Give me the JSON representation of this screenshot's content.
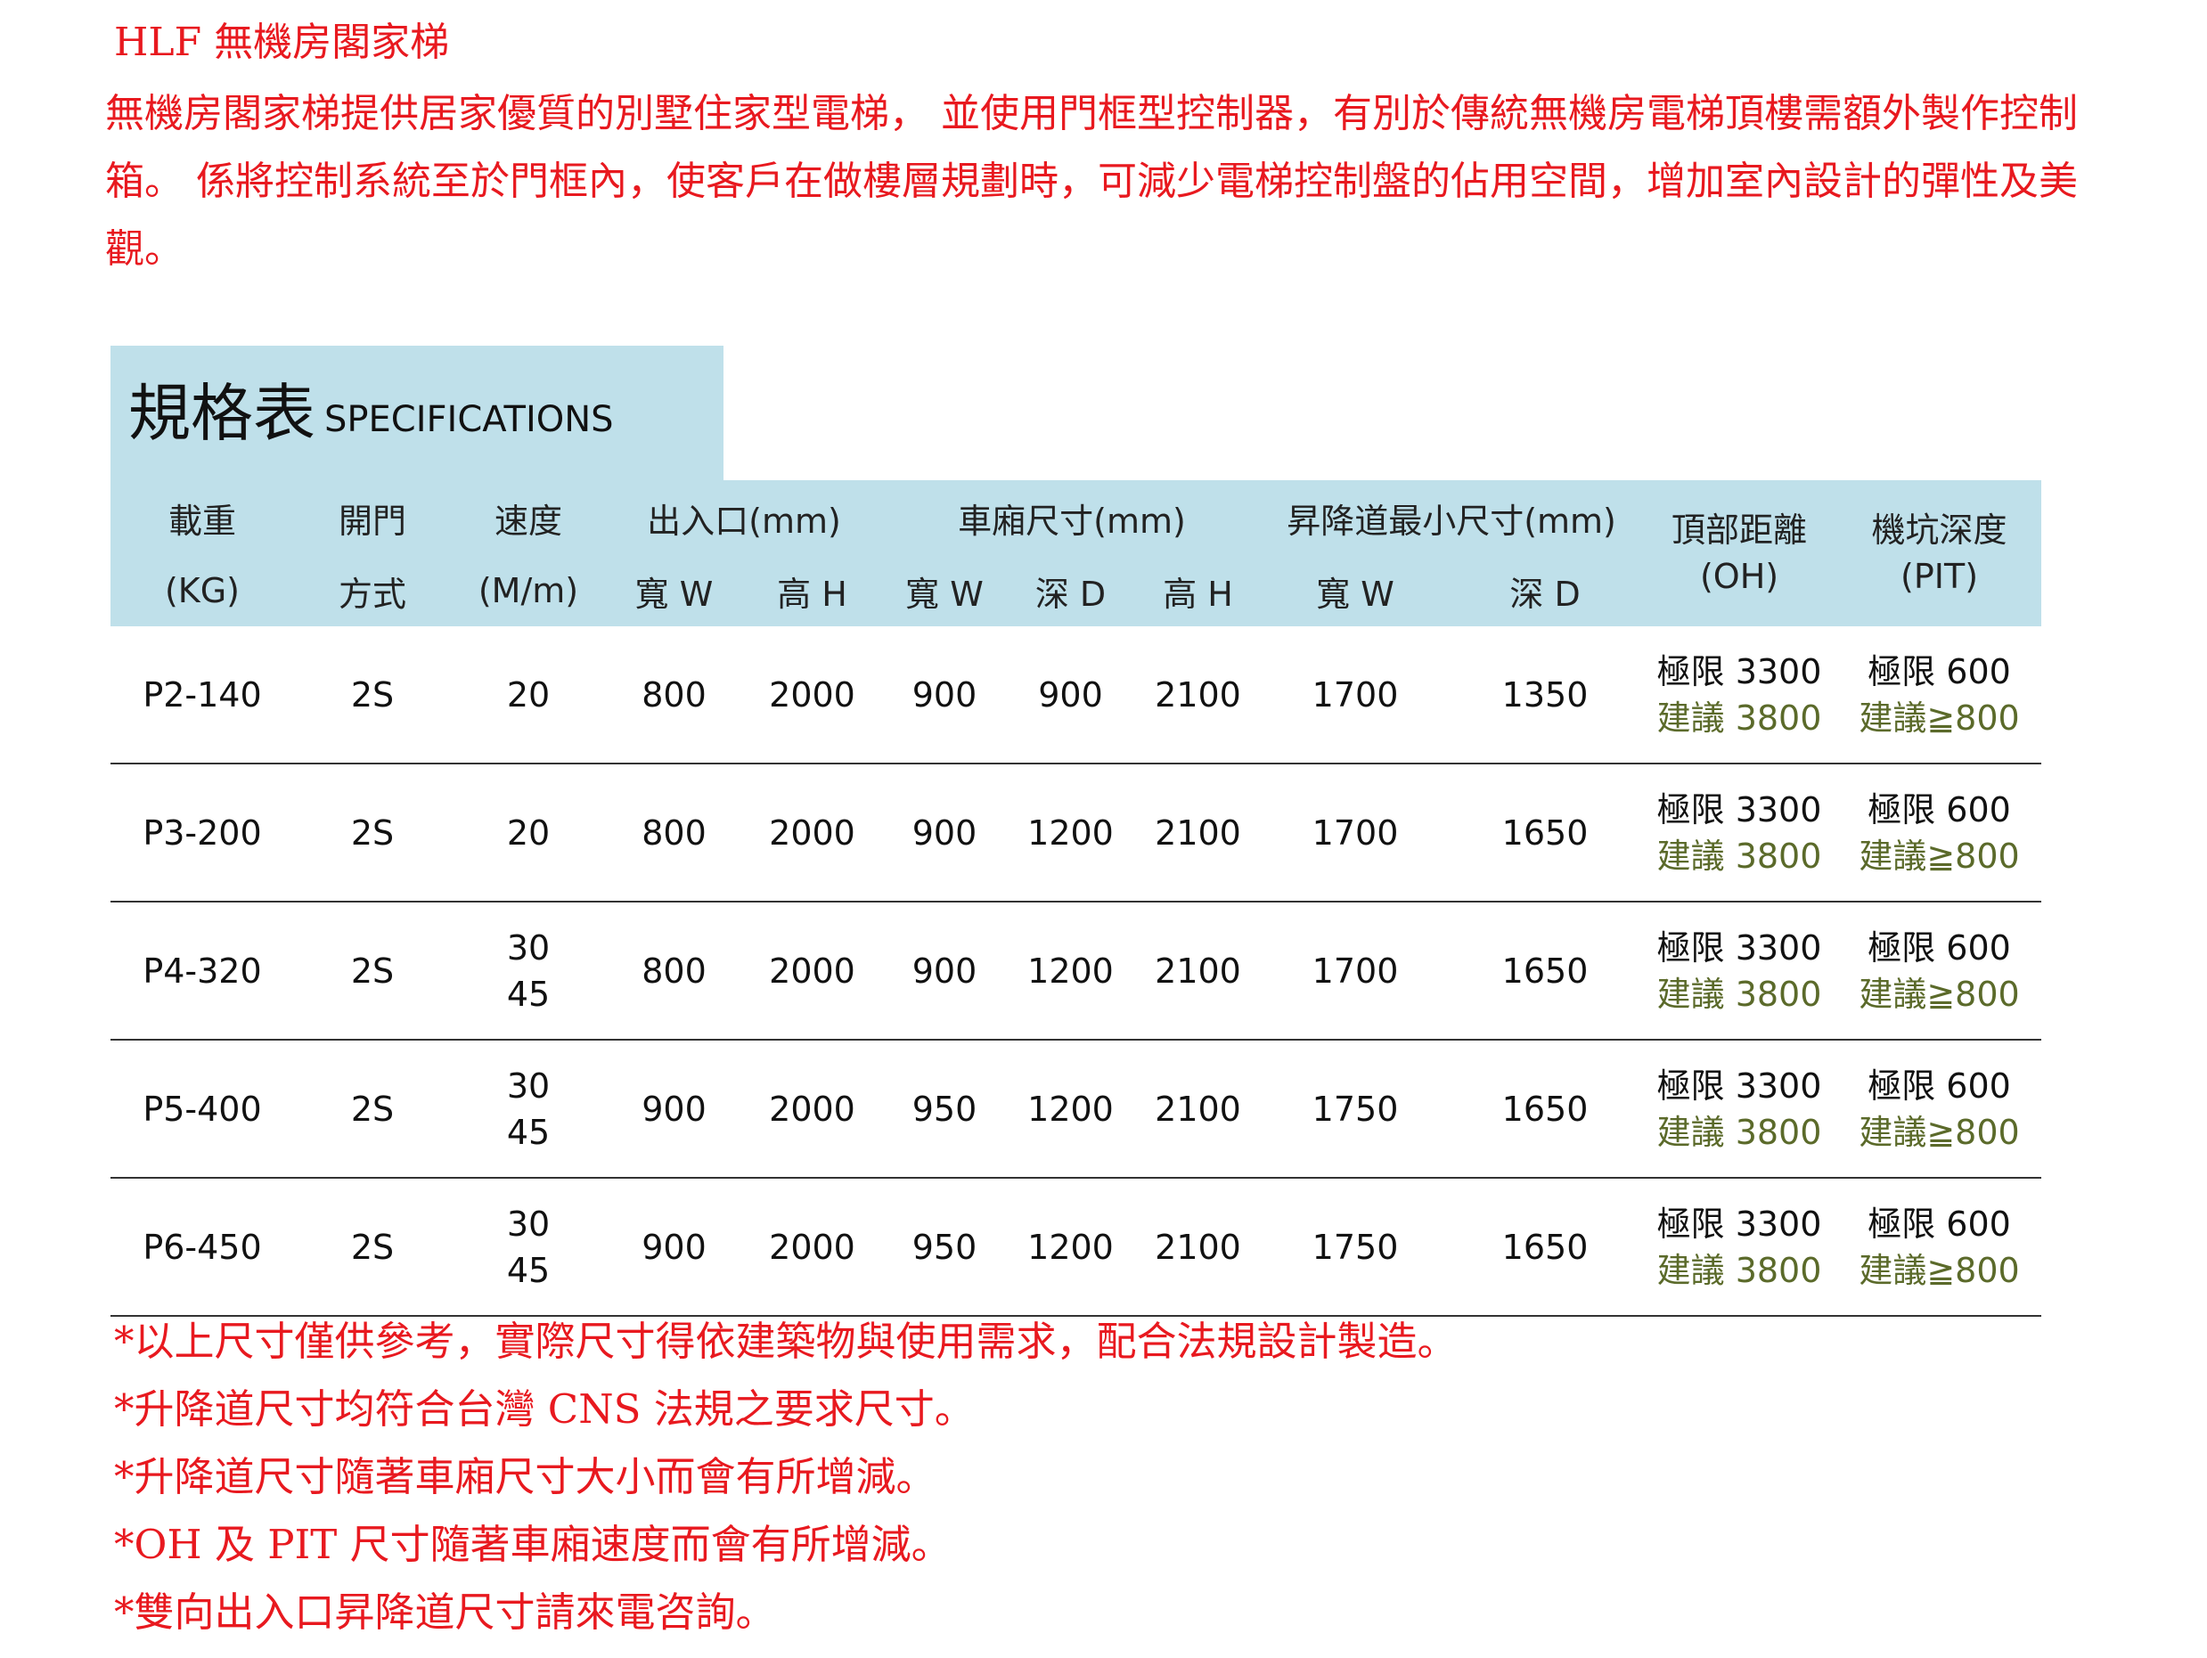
{
  "title": "HLF 無機房閣家梯",
  "intro": "無機房閣家梯提供居家優質的別墅住家型電梯， 並使用門框型控制器，有別於傳統無機房電梯頂樓需額外製作控制箱。 係將控制系統至於門框內，使客戶在做樓層規劃時，可減少電梯控制盤的佔用空間，增加室內設計的彈性及美觀。",
  "spec": {
    "title_zh": "規格表",
    "title_en": "SPECIFICATIONS",
    "headers": {
      "load": "載重",
      "load_unit": "(KG)",
      "door": "開門",
      "door2": "方式",
      "speed": "速度",
      "speed_unit": "(M/m)",
      "entrance": "出入口(mm)",
      "car": "車廂尺寸(mm)",
      "shaft": "昇降道最小尺寸(mm)",
      "oh": "頂部距離",
      "oh_unit": "(OH)",
      "pit": "機坑深度",
      "pit_unit": "(PIT)",
      "width": "寬 W",
      "height": "高 H",
      "depth": "深 D"
    },
    "rows": [
      {
        "model": "P2-140",
        "door": "2S",
        "speed1": "20",
        "speed2": "",
        "ent_w": "800",
        "ent_h": "2000",
        "car_w": "900",
        "car_d": "900",
        "car_h": "2100",
        "shaft_w": "1700",
        "shaft_d": "1350",
        "oh_limit": "極限 3300",
        "oh_rec": "建議 3800",
        "pit_limit": "極限 600",
        "pit_rec": "建議≧800"
      },
      {
        "model": "P3-200",
        "door": "2S",
        "speed1": "20",
        "speed2": "",
        "ent_w": "800",
        "ent_h": "2000",
        "car_w": "900",
        "car_d": "1200",
        "car_h": "2100",
        "shaft_w": "1700",
        "shaft_d": "1650",
        "oh_limit": "極限 3300",
        "oh_rec": "建議 3800",
        "pit_limit": "極限 600",
        "pit_rec": "建議≧800"
      },
      {
        "model": "P4-320",
        "door": "2S",
        "speed1": "30",
        "speed2": "45",
        "ent_w": "800",
        "ent_h": "2000",
        "car_w": "900",
        "car_d": "1200",
        "car_h": "2100",
        "shaft_w": "1700",
        "shaft_d": "1650",
        "oh_limit": "極限 3300",
        "oh_rec": "建議 3800",
        "pit_limit": "極限 600",
        "pit_rec": "建議≧800"
      },
      {
        "model": "P5-400",
        "door": "2S",
        "speed1": "30",
        "speed2": "45",
        "ent_w": "900",
        "ent_h": "2000",
        "car_w": "950",
        "car_d": "1200",
        "car_h": "2100",
        "shaft_w": "1750",
        "shaft_d": "1650",
        "oh_limit": "極限 3300",
        "oh_rec": "建議 3800",
        "pit_limit": "極限 600",
        "pit_rec": "建議≧800"
      },
      {
        "model": "P6-450",
        "door": "2S",
        "speed1": "30",
        "speed2": "45",
        "ent_w": "900",
        "ent_h": "2000",
        "car_w": "950",
        "car_d": "1200",
        "car_h": "2100",
        "shaft_w": "1750",
        "shaft_d": "1650",
        "oh_limit": "極限 3300",
        "oh_rec": "建議 3800",
        "pit_limit": "極限 600",
        "pit_rec": "建議≧800"
      }
    ]
  },
  "notes": [
    "*以上尺寸僅供參考，實際尺寸得依建築物與使用需求，配合法規設計製造。",
    "*升降道尺寸均符合台灣 CNS 法規之要求尺寸。",
    "*升降道尺寸隨著車廂尺寸大小而會有所增減。",
    "*OH 及 PIT 尺寸隨著車廂速度而會有所增減。",
    "*雙向出入口昇降道尺寸請來電咨詢。"
  ],
  "colors": {
    "accent_red": "#e8191f",
    "header_bg": "#bfe0ea",
    "recommend_text": "#5b6a2a"
  }
}
